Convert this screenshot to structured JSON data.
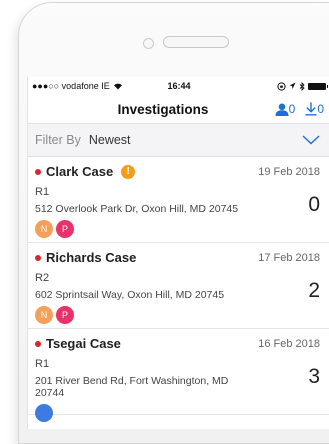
{
  "status": {
    "carrier": "●●●○○ vodafone IE",
    "time": "16:44"
  },
  "header": {
    "title": "Investigations",
    "assigned_count": "0",
    "download_count": "0"
  },
  "filter": {
    "label": "Filter By",
    "value": "Newest"
  },
  "colors": {
    "accent": "#1e6fd9",
    "priority_dot": "#d9262c",
    "warning": "#f59c1a",
    "avatar_n": "#f5a05a",
    "avatar_p": "#e8326b"
  },
  "cases": [
    {
      "name": "Clark Case",
      "date": "19 Feb 2018",
      "ref": "R1",
      "address": "512 Overlook Park Dr, Oxon Hill, MD 20745",
      "count": "0",
      "warning": "!",
      "avatars": [
        "N",
        "P"
      ]
    },
    {
      "name": "Richards Case",
      "date": "17 Feb 2018",
      "ref": "R2",
      "address": "602 Sprintsail Way, Oxon Hill, MD 20745",
      "count": "2",
      "avatars": [
        "N",
        "P"
      ]
    },
    {
      "name": "Tsegai Case",
      "date": "16 Feb 2018",
      "ref": "R1",
      "address": "201 River Bend Rd, Fort Washington, MD 20744",
      "count": "3"
    }
  ]
}
